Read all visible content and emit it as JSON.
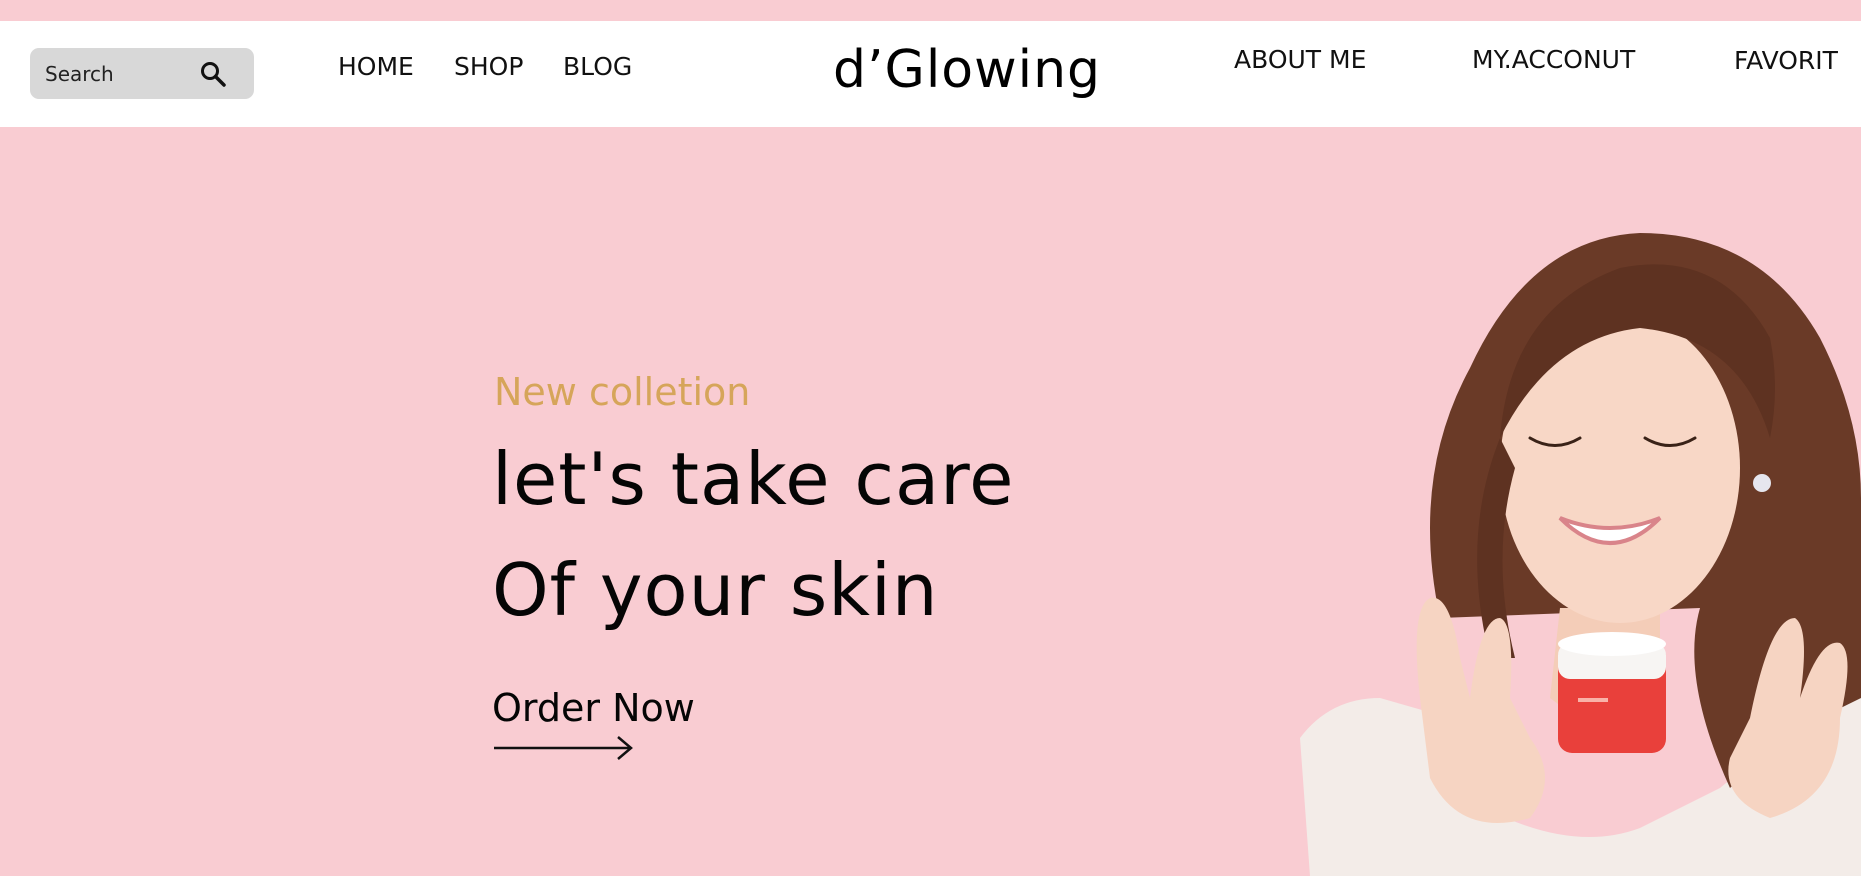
{
  "header": {
    "search": {
      "placeholder": "Search"
    },
    "nav_left": [
      "HOME",
      "SHOP",
      "BLOG"
    ],
    "logo": "d’Glowing",
    "nav_right": [
      "ABOUT ME",
      "MY.ACCONUT",
      "FAVORIT"
    ]
  },
  "hero": {
    "kicker": "New colletion",
    "headline_line1": "let's take care",
    "headline_line2": "Of your skin",
    "cta_label": "Order Now"
  },
  "colors": {
    "page_background": "#f9ccd2",
    "accent_gold": "#d6a55a",
    "navbar_background": "#ffffff",
    "search_background": "#d8d8d8"
  },
  "icons": {
    "search": "search-icon",
    "cta_arrow": "arrow-right-icon"
  }
}
